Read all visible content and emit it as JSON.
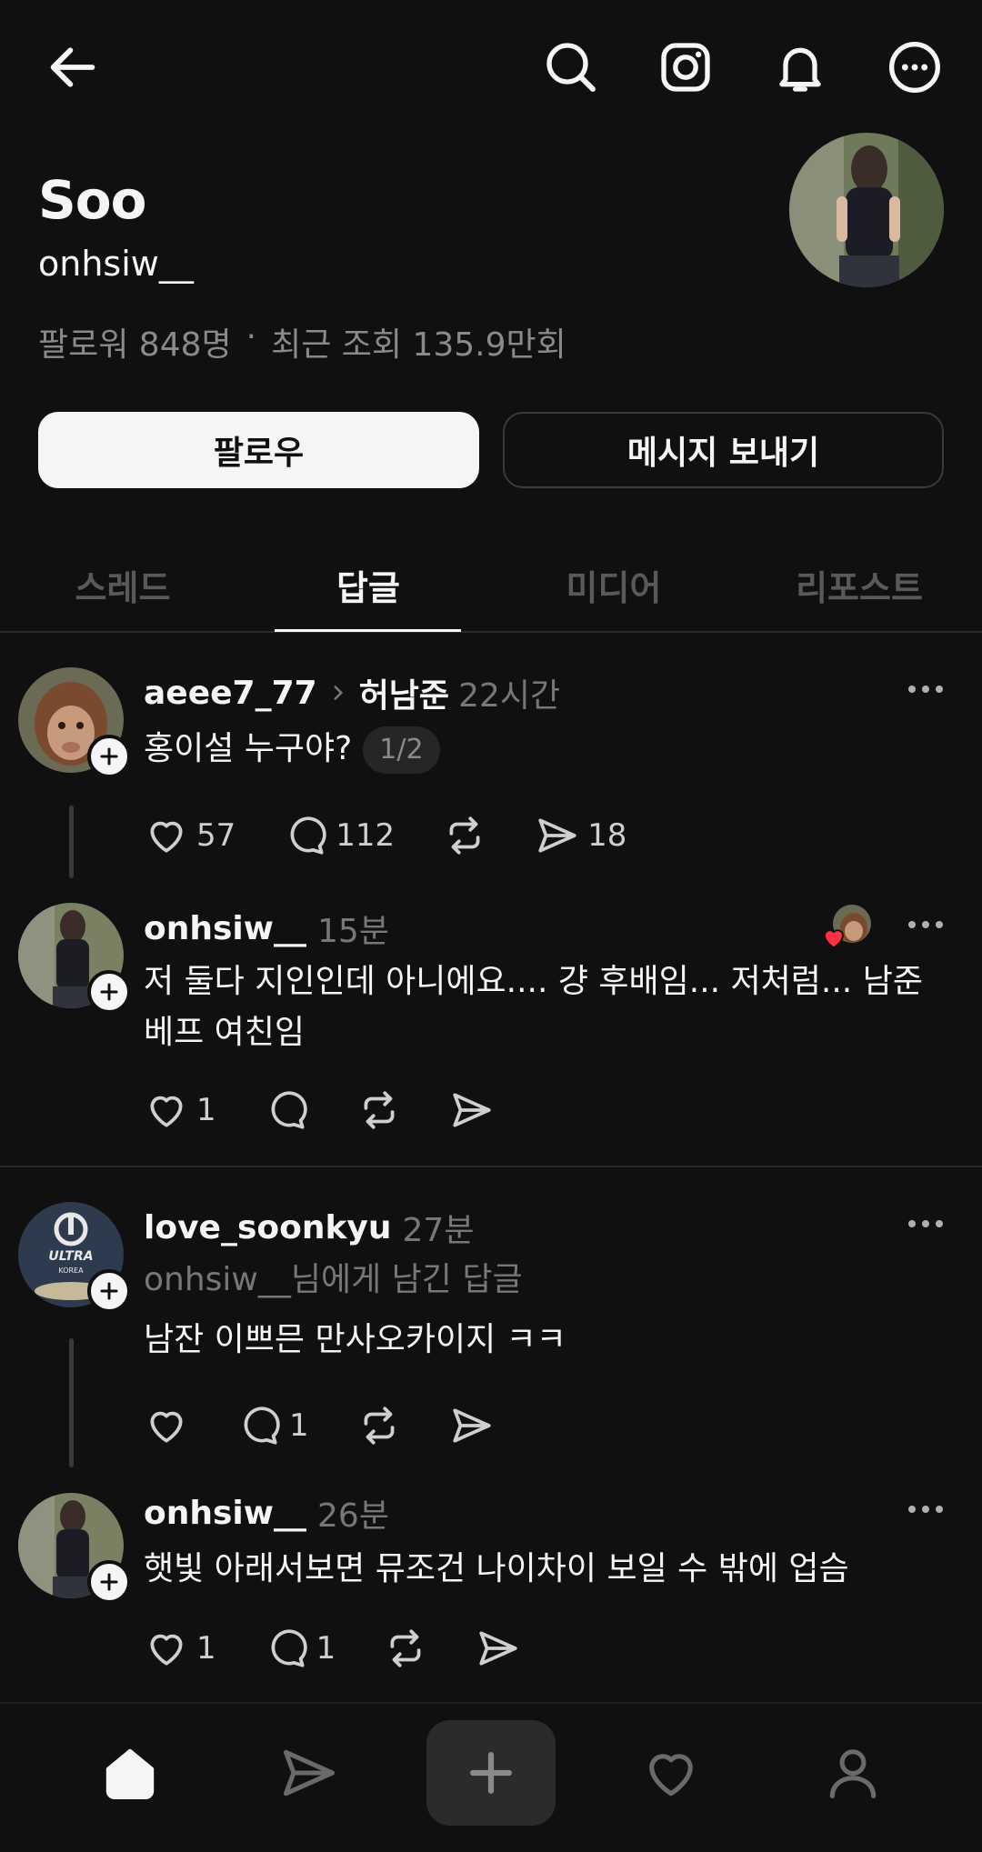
{
  "header": {
    "icons": [
      "back-arrow-icon",
      "search-icon",
      "instagram-icon",
      "bell-icon",
      "more-circle-icon"
    ]
  },
  "profile": {
    "name": "Soo",
    "handle": "onhsiw__",
    "followers": "팔로워 848명",
    "separator": "·",
    "views": "최근 조회 135.9만회",
    "follow_label": "팔로우",
    "message_label": "메시지 보내기"
  },
  "tabs": [
    {
      "label": "스레드",
      "active": false
    },
    {
      "label": "답글",
      "active": true
    },
    {
      "label": "미디어",
      "active": false
    },
    {
      "label": "리포스트",
      "active": false
    }
  ],
  "posts": [
    {
      "user": "aeee7_77",
      "reply_to": "허남준",
      "time": "22시간",
      "text": "홍이설 누구야?",
      "page": "1/2",
      "likes": "57",
      "comments": "112",
      "reposts": "",
      "shares": "18"
    },
    {
      "user": "onhsiw__",
      "time": "15분",
      "text": "저 둘다 지인인데 아니에요.... 걍 후배임... 저처럼... 남준 베프 여친임",
      "likes": "1",
      "comments": "",
      "reposts": "",
      "shares": ""
    },
    {
      "user": "love_soonkyu",
      "time": "27분",
      "context": "onhsiw__님에게 남긴 답글",
      "text": "남잔 이쁘믄  만사오카이지 ㅋㅋ",
      "likes": "",
      "comments": "1",
      "reposts": "",
      "shares": ""
    },
    {
      "user": "onhsiw__",
      "time": "26분",
      "text": "햇빛 아래서보면 뮤조건 나이차이 보일 수 밖에 업슴",
      "likes": "1",
      "comments": "1",
      "reposts": "",
      "shares": ""
    }
  ],
  "bottom_nav": [
    "home-icon",
    "send-icon",
    "plus-icon",
    "heart-icon",
    "profile-icon"
  ],
  "colors": {
    "background": "#101010",
    "text": "#f3f5f7",
    "muted": "#777777",
    "like_red": "#ff3040"
  }
}
